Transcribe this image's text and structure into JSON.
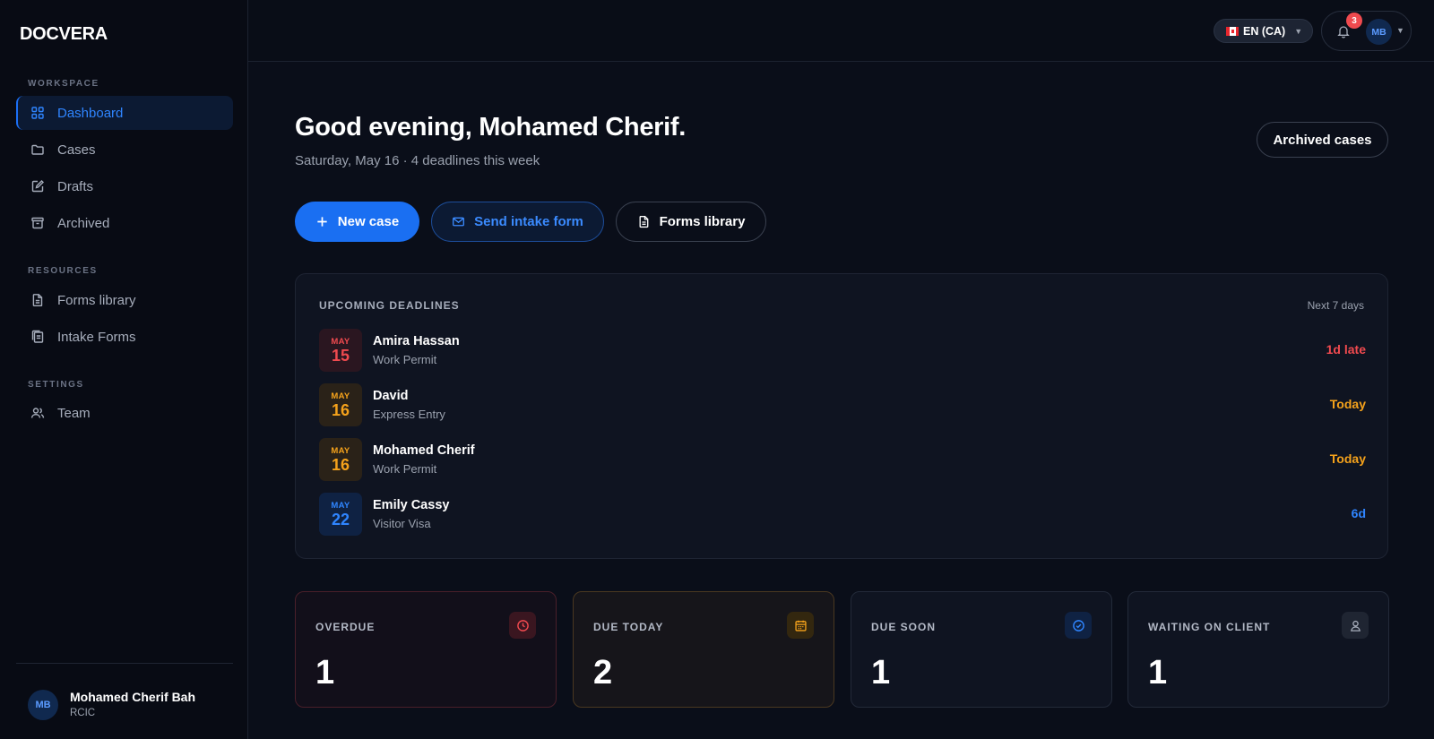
{
  "app": {
    "name": "DOCVERA"
  },
  "sidebar": {
    "sections": {
      "workspace": "WORKSPACE",
      "resources": "RESOURCES",
      "settings": "SETTINGS"
    },
    "items": [
      {
        "label": "Dashboard",
        "icon": "grid-icon",
        "active": true
      },
      {
        "label": "Cases",
        "icon": "folder-icon"
      },
      {
        "label": "Drafts",
        "icon": "pencil-icon"
      },
      {
        "label": "Archived",
        "icon": "archive-icon"
      },
      {
        "label": "Forms library",
        "icon": "document-icon"
      },
      {
        "label": "Intake Forms",
        "icon": "clipboard-icon"
      },
      {
        "label": "Team",
        "icon": "users-icon"
      }
    ],
    "user": {
      "initials": "MB",
      "name": "Mohamed Cherif Bah",
      "role": "RCIC"
    }
  },
  "topbar": {
    "language": "EN (CA)",
    "notifications_count": "3",
    "user_initials": "MB"
  },
  "header": {
    "greeting": "Good evening, Mohamed Cherif.",
    "subtitle": "Saturday, May 16 · 4 deadlines this week",
    "archived_button": "Archived cases"
  },
  "actions": {
    "new_case": "New case",
    "send_intake": "Send intake form",
    "forms_library": "Forms library"
  },
  "deadlines": {
    "title": "UPCOMING DEADLINES",
    "range": "Next 7 days",
    "rows": [
      {
        "month": "MAY",
        "day": "15",
        "name": "Amira Hassan",
        "type": "Work Permit",
        "status": "1d late",
        "tone": "late"
      },
      {
        "month": "MAY",
        "day": "16",
        "name": "David",
        "type": "Express Entry",
        "status": "Today",
        "tone": "today"
      },
      {
        "month": "MAY",
        "day": "16",
        "name": "Mohamed Cherif",
        "type": "Work Permit",
        "status": "Today",
        "tone": "today"
      },
      {
        "month": "MAY",
        "day": "22",
        "name": "Emily Cassy",
        "type": "Visitor Visa",
        "status": "6d",
        "tone": "soon"
      }
    ]
  },
  "stats": [
    {
      "label": "OVERDUE",
      "value": "1",
      "icon": "clock-icon"
    },
    {
      "label": "DUE TODAY",
      "value": "2",
      "icon": "calendar-icon"
    },
    {
      "label": "DUE SOON",
      "value": "1",
      "icon": "check-circle-icon"
    },
    {
      "label": "WAITING ON CLIENT",
      "value": "1",
      "icon": "user-icon"
    }
  ],
  "colors": {
    "accent": "#1a6ff2",
    "late": "#f04a4f",
    "today": "#f5a21b",
    "soon": "#2f85ff"
  }
}
